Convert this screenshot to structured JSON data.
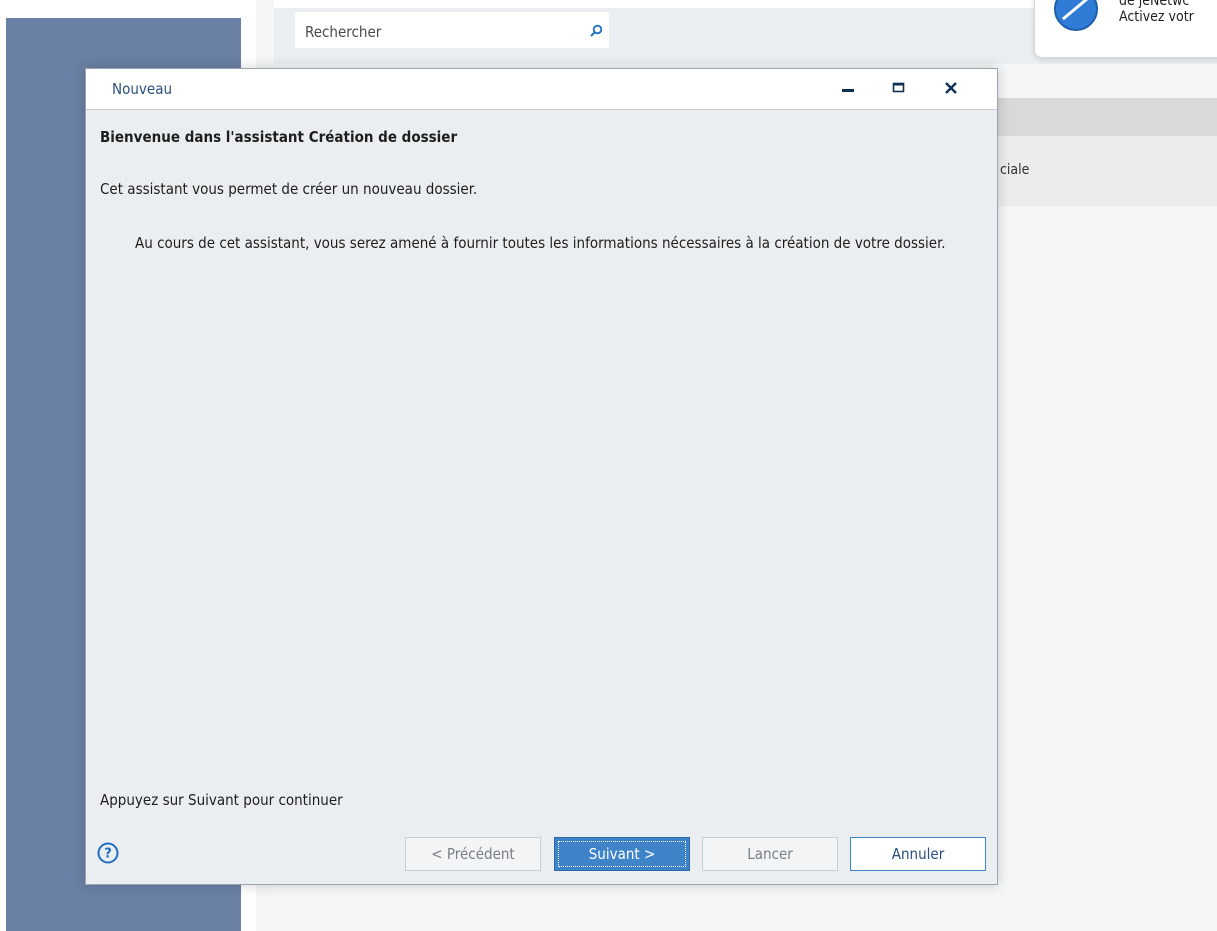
{
  "background": {
    "search": {
      "placeholder": "Rechercher",
      "icon": "search-icon"
    },
    "notification": {
      "line1": "de jeNetwc",
      "line2": "Activez votr",
      "icon": "compass-icon"
    },
    "partial_text": "ciale"
  },
  "dialog": {
    "title": "Nouveau",
    "heading": "Bienvenue dans l'assistant Création de dossier",
    "intro": "Cet assistant vous permet de créer un nouveau dossier.",
    "detail": "Au cours de cet assistant, vous serez amené à fournir toutes les informations nécessaires à la création de votre dossier.",
    "continue_hint": "Appuyez sur Suivant pour continuer",
    "buttons": {
      "prev": "< Précédent",
      "next": "Suivant >",
      "launch": "Lancer",
      "cancel": "Annuler"
    },
    "colors": {
      "accent": "#3f83c9",
      "title": "#2a4f7c",
      "sidebar": "#6a80a4"
    }
  }
}
